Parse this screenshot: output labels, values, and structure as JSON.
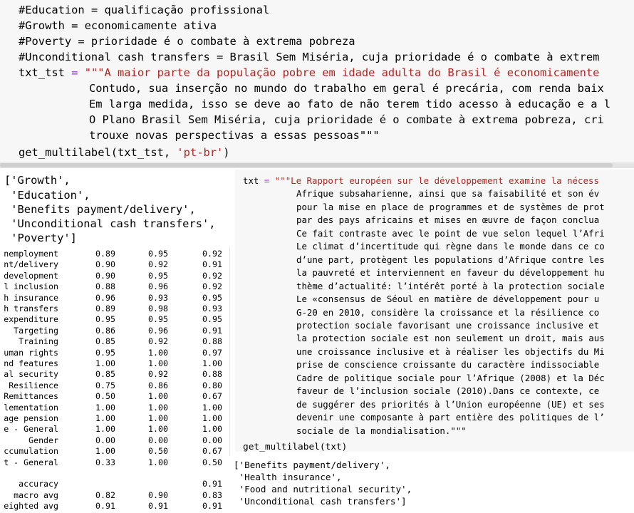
{
  "top_cell": {
    "comment_education": "#Education = qualificação profissional",
    "comment_growth": "#Growth = economicamente ativa",
    "comment_poverty": "#Poverty = prioridade é o combate à extrema pobreza",
    "comment_uct": "#Unconditional cash transfers = Brasil Sem Miséria, cuja prioridade é o combate à extrem",
    "assign_var": "txt_tst",
    "assign_op": " = ",
    "string_lines": [
      "\"\"\"A maior parte da população pobre em idade adulta do Brasil é economicamente",
      "Contudo, sua inserção no mundo do trabalho em geral é precária, com renda baix",
      "Em larga medida, isso se deve ao fato de não terem tido acesso à educação e a l",
      "O Plano Brasil Sem Miséria, cuja prioridade é o combate à extrema pobreza, cri",
      "trouxe novas perspectivas a essas pessoas\"\"\""
    ],
    "call_func": "get_multilabel(txt_tst, ",
    "call_arg": "'pt-br'",
    "call_close": ")"
  },
  "left_output": {
    "lines": [
      "['Growth',",
      " 'Education',",
      " 'Benefits payment/delivery',",
      " 'Unconditional cash transfers',",
      " 'Poverty']"
    ]
  },
  "report": {
    "rows": [
      {
        "label": "nemployment",
        "p": "0.89",
        "r": "0.95",
        "f": "0.92"
      },
      {
        "label": "nt/delivery",
        "p": "0.90",
        "r": "0.92",
        "f": "0.91"
      },
      {
        "label": "development",
        "p": "0.90",
        "r": "0.95",
        "f": "0.92"
      },
      {
        "label": "l inclusion",
        "p": "0.88",
        "r": "0.96",
        "f": "0.92"
      },
      {
        "label": "h insurance",
        "p": "0.96",
        "r": "0.93",
        "f": "0.95"
      },
      {
        "label": "h transfers",
        "p": "0.89",
        "r": "0.98",
        "f": "0.93"
      },
      {
        "label": "expenditure",
        "p": "0.95",
        "r": "0.95",
        "f": "0.95"
      },
      {
        "label": "Targeting",
        "p": "0.86",
        "r": "0.96",
        "f": "0.91"
      },
      {
        "label": "Training",
        "p": "0.85",
        "r": "0.92",
        "f": "0.88"
      },
      {
        "label": "uman rights",
        "p": "0.95",
        "r": "1.00",
        "f": "0.97"
      },
      {
        "label": "nd features",
        "p": "1.00",
        "r": "1.00",
        "f": "1.00"
      },
      {
        "label": "al security",
        "p": "0.85",
        "r": "0.92",
        "f": "0.88"
      },
      {
        "label": "Resilience",
        "p": "0.75",
        "r": "0.86",
        "f": "0.80"
      },
      {
        "label": "Remittances",
        "p": "0.50",
        "r": "1.00",
        "f": "0.67"
      },
      {
        "label": "lementation",
        "p": "1.00",
        "r": "1.00",
        "f": "1.00"
      },
      {
        "label": "age pension",
        "p": "1.00",
        "r": "1.00",
        "f": "1.00"
      },
      {
        "label": "e - General",
        "p": "1.00",
        "r": "1.00",
        "f": "1.00"
      },
      {
        "label": "Gender",
        "p": "0.00",
        "r": "0.00",
        "f": "0.00"
      },
      {
        "label": "ccumulation",
        "p": "1.00",
        "r": "0.50",
        "f": "0.67"
      },
      {
        "label": "t - General",
        "p": "0.33",
        "r": "1.00",
        "f": "0.50"
      },
      {
        "label": "",
        "p": "",
        "r": "",
        "f": ""
      },
      {
        "label": "accuracy",
        "p": "",
        "r": "",
        "f": "0.91"
      },
      {
        "label": "macro avg",
        "p": "0.82",
        "r": "0.90",
        "f": "0.83"
      },
      {
        "label": "eighted avg",
        "p": "0.91",
        "r": "0.91",
        "f": "0.91"
      }
    ]
  },
  "right_cell": {
    "assign_var": "txt",
    "assign_op": " = ",
    "string_lines": [
      "\"\"\"Le Rapport européen sur le développement examine la nécess",
      "Afrique subsaharienne, ainsi que sa faisabilité et son év",
      "pour la mise en place de programmes et de systèmes de prot",
      "par des pays africains et mises en œuvre de façon conclua",
      "Ce fait contraste avec le point de vue selon lequel l’Afri",
      "Le climat d’incertitude qui règne dans le monde dans ce co",
      "d’une part, protègent les populations d’Afrique contre les",
      "la pauvreté et interviennent en faveur du développement hu",
      "thème d’actualité: l’intérêt porté à la protection sociale",
      "Le «consensus de Séoul en matière de développement pour u",
      "G-20 en 2010, considère la croissance et la résilience co",
      "protection sociale favorisant une croissance inclusive et",
      "la protection sociale est non seulement un droit, mais aus",
      "une croissance inclusive et à réaliser les objectifs du Mi",
      "prise de conscience croissante du caractère indissociable",
      "Cadre de politique sociale pour l’Afrique (2008) et la Déc",
      "faveur de l’inclusion sociale (2010).Dans ce contexte, ce",
      "de suggérer des priorités à l’Union européenne (UE) et ses",
      "devenir une composante à part entière des politiques de l’",
      "sociale de la mondialisation.\"\"\""
    ],
    "call": "get_multilabel(txt)"
  },
  "right_output": {
    "lines": [
      "['Benefits payment/delivery',",
      " 'Health insurance',",
      " 'Food and nutritional security',",
      " 'Unconditional cash transfers']"
    ]
  }
}
